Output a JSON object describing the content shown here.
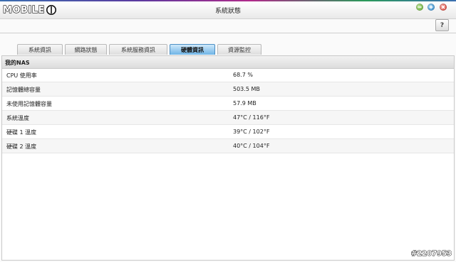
{
  "window": {
    "title": "系統狀態",
    "logo_text": "MOBILE",
    "help_label": "?"
  },
  "tabs": [
    {
      "label": "系統資訊",
      "active": false
    },
    {
      "label": "網路狀態",
      "active": false
    },
    {
      "label": "系統服務資訊",
      "active": false
    },
    {
      "label": "硬體資訊",
      "active": true
    },
    {
      "label": "資源監控",
      "active": false
    }
  ],
  "section": {
    "title": "我的NAS",
    "rows": [
      {
        "label": "CPU 使用率",
        "value": "68.7 %"
      },
      {
        "label": "記憶體總容量",
        "value": "503.5 MB"
      },
      {
        "label": "未使用記憶體容量",
        "value": "57.9 MB"
      },
      {
        "label": "系統溫度",
        "value": "47°C / 116°F"
      },
      {
        "label": "硬碟 1 溫度",
        "value": "39°C / 102°F"
      },
      {
        "label": "硬碟 2 溫度",
        "value": "40°C / 104°F"
      }
    ]
  },
  "watermark": "#2207953",
  "colors": {
    "active_tab": "#6fb4e6",
    "minimize": "#5aa52a",
    "maximize": "#2a83c8",
    "close": "#d23a2e"
  },
  "icons": [
    "minimize-icon",
    "maximize-icon",
    "close-icon",
    "help-icon"
  ]
}
